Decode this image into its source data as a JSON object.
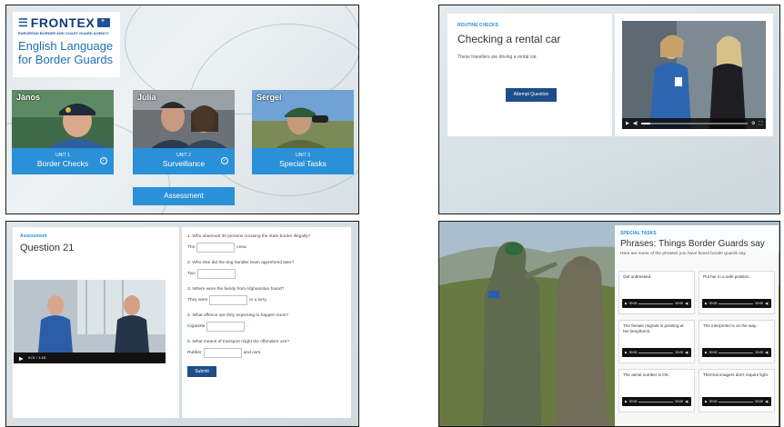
{
  "panel1": {
    "logo": {
      "brand": "FRONTEX",
      "agency": "EUROPEAN BORDER AND COAST GUARD AGENCY",
      "course_title": "English Language for Border Guards"
    },
    "units": [
      {
        "person": "János",
        "number": "UNIT 1",
        "title": "Border Checks",
        "completed": true
      },
      {
        "person": "Júlia",
        "number": "UNIT 2",
        "title": "Surveillance",
        "completed": true
      },
      {
        "person": "Sergei",
        "number": "UNIT 3",
        "title": "Special Tasks",
        "completed": false
      }
    ],
    "assessment_label": "Assessment",
    "accent_color": "#2a90d8"
  },
  "panel2": {
    "category": "ROUTINE CHECKS",
    "title": "Checking a rental car",
    "description": "These travellers are driving a rental car.",
    "attempt_label": "Attempt Question",
    "video_progress": 0.08
  },
  "panel3": {
    "category": "Assessment",
    "title": "Question 21",
    "video_time": "0:01 / 1:18",
    "questions": [
      {
        "q": "1. Who observed 30 persons crossing the state border illegally?",
        "before": "The",
        "after": "crew."
      },
      {
        "q": "2. Who else did the dog handler team apprehend later?",
        "before": "Two",
        "after": "."
      },
      {
        "q": "3. Where were the family from Afghanistan found?",
        "before": "They were",
        "after": "in a lorry."
      },
      {
        "q": "4. What offence are they expecting to happen soon?",
        "before": "Cigarette",
        "after": "."
      },
      {
        "q": "5. What means of transport might the offenders use?",
        "before": "Rubber",
        "after": "and cars."
      }
    ],
    "submit_label": "Submit"
  },
  "panel4": {
    "category": "SPECIAL TASKS",
    "title": "Phrases: Things Border Guards say",
    "subtitle": "Here are some of the phrases you have heard border guards say",
    "phrases": [
      "Get undressed.",
      "Put her in a safe position.",
      "The female migrant is pointing at her lamp/torch.",
      "The interpreter is on the way.",
      "The aerial number is OK.",
      "Thermal imagers don't require light."
    ],
    "audio_time": "00:00"
  }
}
